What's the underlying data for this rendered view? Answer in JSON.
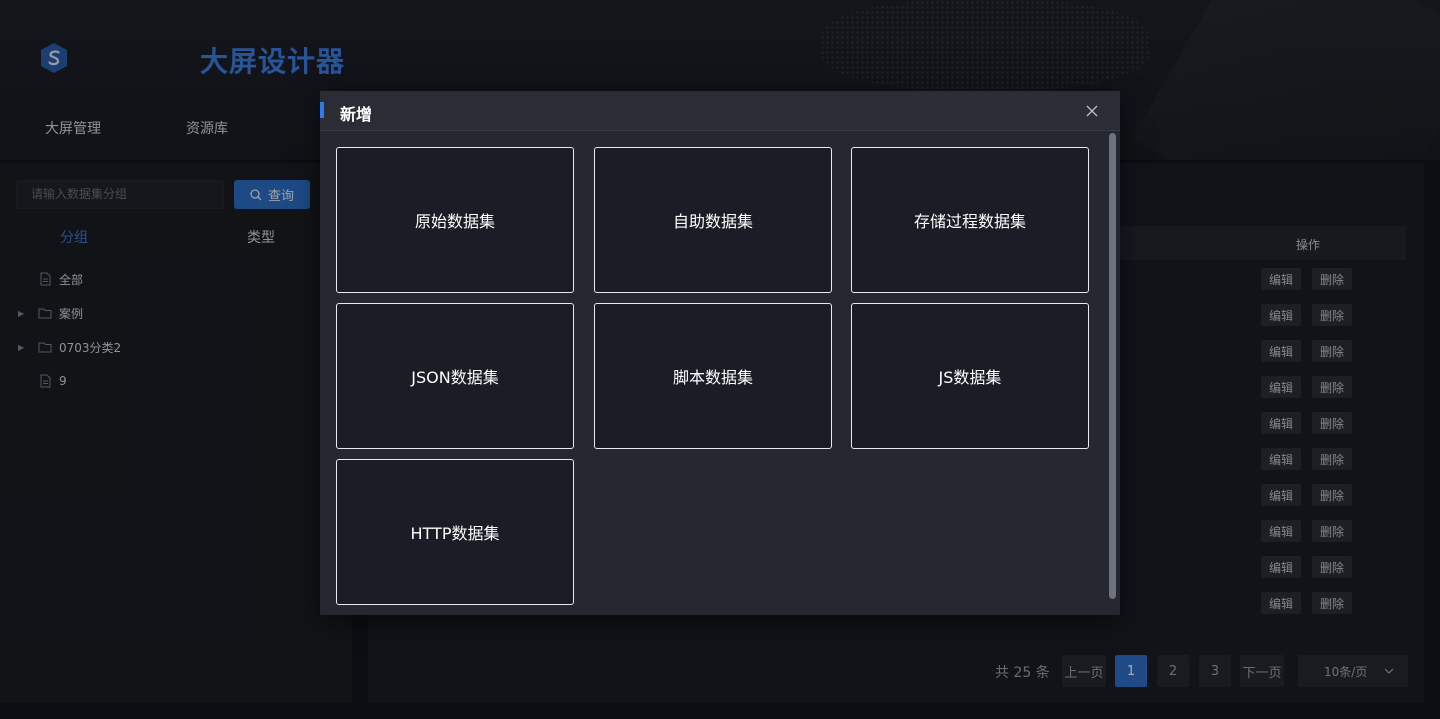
{
  "header": {
    "title": "大屏设计器",
    "nav": [
      "大屏管理",
      "资源库"
    ]
  },
  "left": {
    "search_placeholder": "请输入数据集分组",
    "query_label": "查询",
    "tabs": {
      "group": "分组",
      "type": "类型"
    },
    "tree": [
      {
        "label": "全部",
        "icon": "file-icon",
        "expandable": false
      },
      {
        "label": "案例",
        "icon": "folder-icon",
        "expandable": true
      },
      {
        "label": "0703分类2",
        "icon": "folder-icon",
        "expandable": true
      },
      {
        "label": "9",
        "icon": "file-icon",
        "expandable": false
      }
    ]
  },
  "table": {
    "ops_header": "操作",
    "edit_label": "编辑",
    "delete_label": "删除",
    "row_count": 10
  },
  "pagination": {
    "total_text": "共 25 条",
    "prev": "上一页",
    "next": "下一页",
    "pages": [
      "1",
      "2",
      "3"
    ],
    "current": "1",
    "page_size": "10条/页"
  },
  "modal": {
    "title": "新增",
    "cards": [
      "原始数据集",
      "自助数据集",
      "存储过程数据集",
      "JSON数据集",
      "脚本数据集",
      "JS数据集",
      "HTTP数据集"
    ]
  },
  "colors": {
    "accent": "#2f7bea",
    "brand_title": "#3b7ee0",
    "active_tab": "#3a78d6",
    "modal_bg": "#252831",
    "card_bg": "#1b1d26"
  }
}
